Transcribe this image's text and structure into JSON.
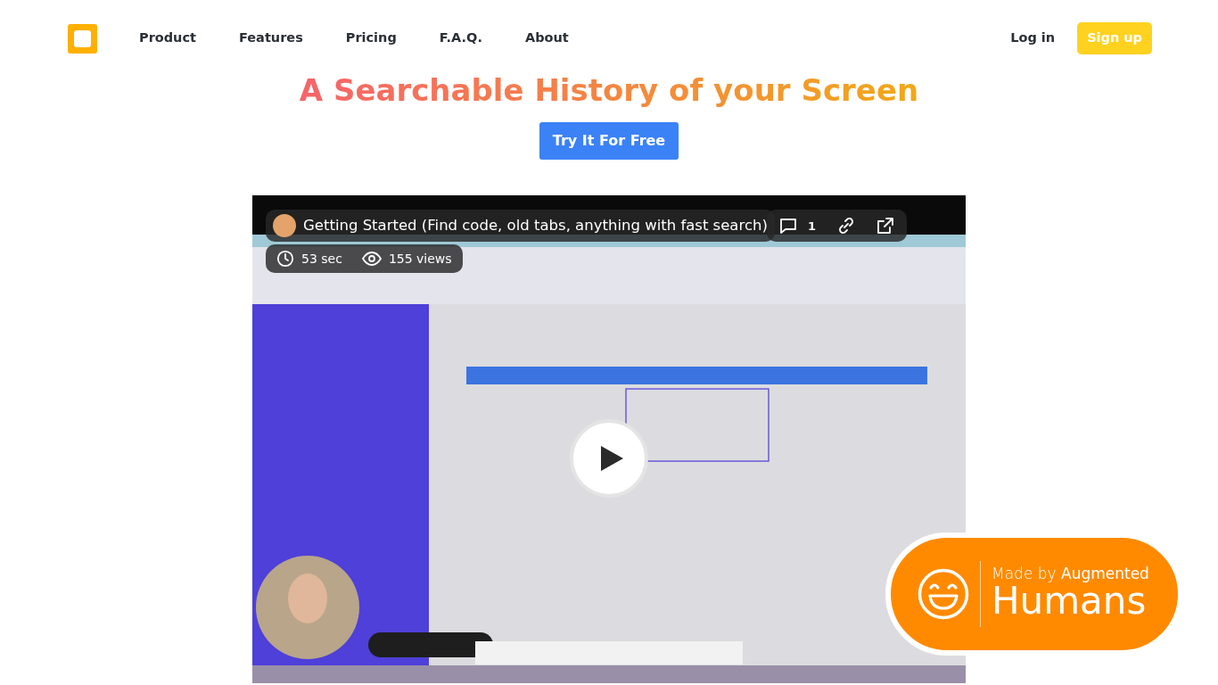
{
  "nav": {
    "links": [
      {
        "label": "Product"
      },
      {
        "label": "Features"
      },
      {
        "label": "Pricing"
      },
      {
        "label": "F.A.Q."
      },
      {
        "label": "About"
      }
    ],
    "login": "Log in",
    "signup": "Sign up"
  },
  "hero": {
    "title": "A Searchable History of your Screen",
    "cta": "Try It For Free"
  },
  "video": {
    "title": "Getting Started (Find code, old tabs, anything with fast search)",
    "comments": "1",
    "duration": "53 sec",
    "views": "155 views"
  },
  "badge": {
    "tagline": "Made by **Augmented**",
    "name": "Humans"
  }
}
